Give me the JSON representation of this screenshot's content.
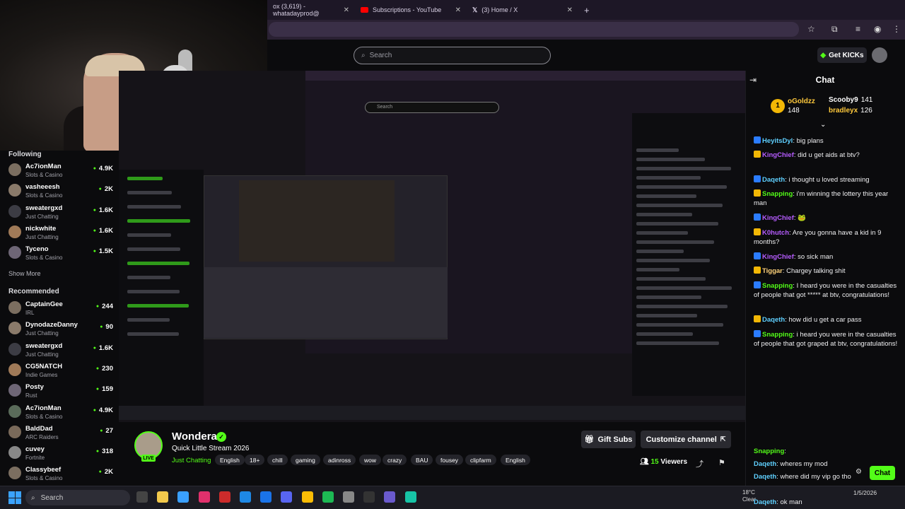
{
  "browser": {
    "tabs": [
      {
        "label": "ox (3,619) - whatadayprod@",
        "icon": "gmail-icon"
      },
      {
        "label": "Subscriptions - YouTube",
        "icon": "youtube-icon"
      },
      {
        "label": "(3) Home / X",
        "icon": "x-icon"
      }
    ],
    "new_tab": "+"
  },
  "header": {
    "search_placeholder": "Search",
    "get_kicks": "Get KICKs"
  },
  "sidebar": {
    "following_title": "Following",
    "following": [
      {
        "name": "Ac7ionMan",
        "category": "Slots & Casino",
        "viewers": "4.9K"
      },
      {
        "name": "vasheeesh",
        "category": "Slots & Casino",
        "viewers": "2K"
      },
      {
        "name": "sweatergxd",
        "category": "Just Chatting",
        "viewers": "1.6K"
      },
      {
        "name": "nickwhite",
        "category": "Just Chatting",
        "viewers": "1.6K"
      },
      {
        "name": "Tyceno",
        "category": "Slots & Casino",
        "viewers": "1.5K"
      }
    ],
    "show_more": "Show More",
    "recommended_title": "Recommended",
    "recommended": [
      {
        "name": "CaptainGee",
        "category": "IRL",
        "viewers": "244"
      },
      {
        "name": "DynodazeDanny",
        "category": "Just Chatting",
        "viewers": "90"
      },
      {
        "name": "sweatergxd",
        "category": "Just Chatting",
        "viewers": "1.6K"
      },
      {
        "name": "CG5NATCH",
        "category": "Indie Games",
        "viewers": "230"
      },
      {
        "name": "Posty",
        "category": "Rust",
        "viewers": "159"
      },
      {
        "name": "Ac7ionMan",
        "category": "Slots & Casino",
        "viewers": "4.9K"
      },
      {
        "name": "BaldDad",
        "category": "ARC Raiders",
        "viewers": "27"
      },
      {
        "name": "cuvey",
        "category": "Fortnite",
        "viewers": "318"
      },
      {
        "name": "Classybeef",
        "category": "Slots & Casino",
        "viewers": "2K"
      }
    ]
  },
  "stream": {
    "streamer": "Wondera",
    "live": "LIVE",
    "title": "Quick Little Stream 2026",
    "category": "Just Chatting",
    "tags": [
      "English",
      "18+",
      "chill",
      "gaming",
      "adinross",
      "wow",
      "crazy",
      "BAU",
      "fousey",
      "clipfarm",
      "English"
    ],
    "gift_subs": "Gift Subs",
    "customize": "Customize channel",
    "viewers_count": "15",
    "viewers_label": "Viewers"
  },
  "chat": {
    "title": "Chat",
    "top_gifters": [
      {
        "name": "oGoldzz",
        "count": "148"
      },
      {
        "name": "Scooby9",
        "count": "141"
      },
      {
        "name": "bradleyx",
        "count": "126"
      }
    ],
    "messages": [
      {
        "user": "HeyitsDyl",
        "color": "#5fd0ff",
        "text": "big plans"
      },
      {
        "user": "KingChief",
        "color": "#b65cff",
        "text": "did u get aids at btv?"
      },
      {
        "user": "Daqeth",
        "color": "#5fd0ff",
        "text": "i thought u loved streaming"
      },
      {
        "user": "Snapping",
        "color": "#53fc18",
        "text": "i'm winning the lottery this year man"
      },
      {
        "user": "KingChief",
        "color": "#b65cff",
        "text": "🐸"
      },
      {
        "user": "K0hutch",
        "color": "#b65cff",
        "text": "Are you gonna have a kid in 9 months?"
      },
      {
        "user": "KingChief",
        "color": "#b65cff",
        "text": "so sick man"
      },
      {
        "user": "Tiggar",
        "color": "#ffd27a",
        "text": "Chargey talking shit"
      },
      {
        "user": "Snapping",
        "color": "#53fc18",
        "text": "I heard you were in the casualties of people that got ***** at btv, congratulations!"
      },
      {
        "user": "Daqeth",
        "color": "#5fd0ff",
        "text": "how did u get a car pass"
      },
      {
        "user": "Snapping",
        "color": "#53fc18",
        "text": "i heard you were in the casualties of people that got graped at btv, congratulations!"
      },
      {
        "user": "Snapping",
        "color": "#53fc18",
        "text": ""
      },
      {
        "user": "Daqeth",
        "color": "#5fd0ff",
        "text": "wheres my mod"
      },
      {
        "user": "Daqeth",
        "color": "#5fd0ff",
        "text": "where did my vip go tho"
      },
      {
        "user": "Daqeth",
        "color": "#5fd0ff",
        "text": "ok man"
      }
    ],
    "send_label": "Chat"
  },
  "taskbar": {
    "search": "Search",
    "weather_temp": "18°C",
    "weather_desc": "Clear",
    "date": "1/5/2026"
  }
}
